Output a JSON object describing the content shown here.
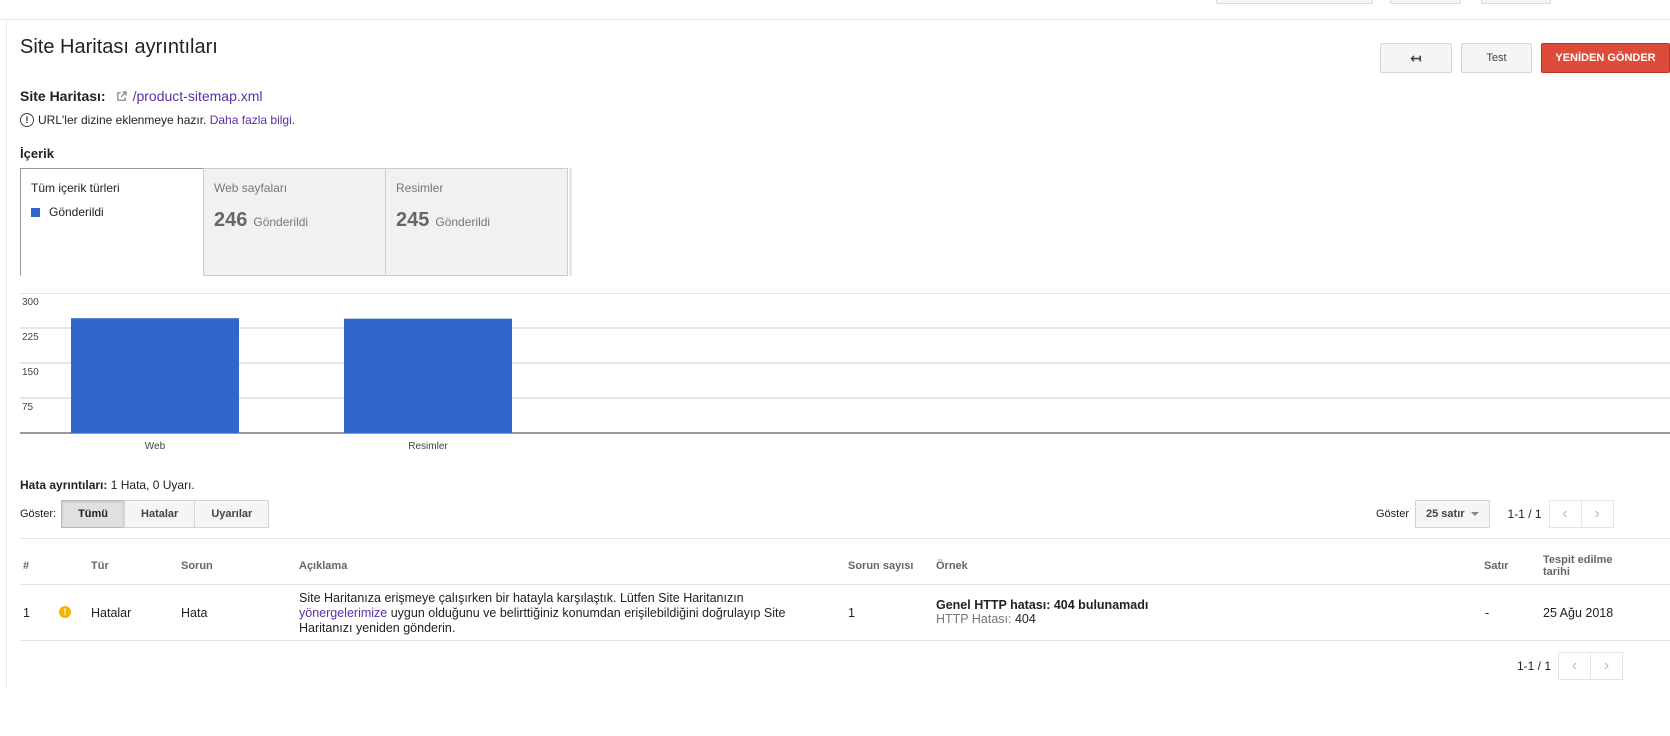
{
  "header": {
    "page_title": "Site Haritası ayrıntıları",
    "back_label": "↤",
    "test_label": "Test",
    "resubmit_label": "YENİDEN GÖNDER"
  },
  "sitemap": {
    "label": "Site Haritası:",
    "url": "/product-sitemap.xml",
    "status_text": "URL'ler dizine eklenmeye hazır.",
    "more_info": "Daha fazla bilgi."
  },
  "content": {
    "title": "İçerik",
    "tabs": [
      {
        "label": "Tüm içerik türleri",
        "legend": "Gönderildi"
      },
      {
        "label": "Web sayfaları",
        "count": "246",
        "suffix": "Gönderildi"
      },
      {
        "label": "Resimler",
        "count": "245",
        "suffix": "Gönderildi"
      }
    ]
  },
  "chart_data": {
    "type": "bar",
    "categories": [
      "Web",
      "Resimler"
    ],
    "series": [
      {
        "name": "Gönderildi",
        "values": [
          246,
          245
        ]
      }
    ],
    "yticks": [
      75,
      150,
      225,
      300
    ],
    "ylim": [
      0,
      300
    ],
    "grid": true,
    "color": "#3366cc"
  },
  "errors": {
    "summary_label": "Hata ayrıntıları:",
    "summary_value": "1 Hata, 0 Uyarı.",
    "filter_label": "Göster:",
    "filters": [
      "Tümü",
      "Hatalar",
      "Uyarılar"
    ],
    "rows_label": "Göster",
    "rows_value": "25 satır",
    "range": "1-1 / 1"
  },
  "table": {
    "headers": [
      "#",
      "Tür",
      "Sorun",
      "Açıklama",
      "Sorun sayısı",
      "Örnek",
      "Satır",
      "Tespit edilme tarihi"
    ],
    "rows": [
      {
        "index": "1",
        "type": "Hatalar",
        "issue": "Hata",
        "desc_a": "Site Haritanıza erişmeye çalışırken bir hatayla karşılaştık. Lütfen Site Haritanızın",
        "desc_link": "yönergelerimize",
        "desc_b": "uygun olduğunu ve belirttiğiniz konumdan erişilebildiğini doğrulayıp Site Haritanızı yeniden gönderin.",
        "count": "1",
        "example_title": "Genel HTTP hatası: 404 bulunamadı",
        "example_sub_label": "HTTP Hatası:",
        "example_sub_value": "404",
        "line": "-",
        "date": "25 Ağu 2018"
      }
    ]
  }
}
